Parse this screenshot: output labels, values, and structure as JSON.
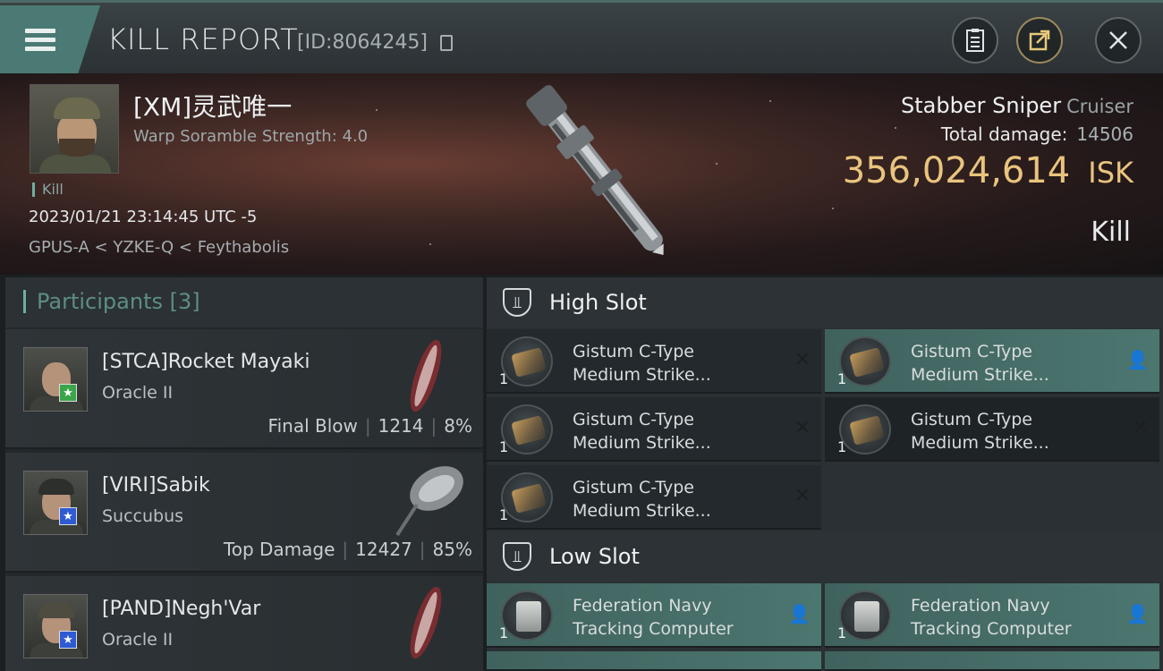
{
  "header": {
    "title": "KILL REPORT",
    "report_id": "[ID:8064245]"
  },
  "victim": {
    "name": "[XM]灵武唯一",
    "subtitle": "Warp Soramble Strength: 4.0",
    "tag": "Kill",
    "time": "2023/01/21 23:14:45 UTC -5",
    "location": "GPUS-A < YZKE-Q < Feythabolis",
    "ship_name": "Stabber Sniper",
    "ship_class": "Cruiser",
    "total_damage_label": "Total damage:",
    "total_damage": "14506",
    "isk_value": "356,024,614",
    "isk_unit": "ISK",
    "result": "Kill"
  },
  "participants": {
    "title": "Participants [3]",
    "items": [
      {
        "name": "[STCA]Rocket Mayaki",
        "ship": "Oracle II",
        "label": "Final Blow",
        "damage": "1214",
        "percent": "8%",
        "badge": "★",
        "badge_color": "#3aa54b"
      },
      {
        "name": "[VIRI]Sabik",
        "ship": "Succubus",
        "label": "Top Damage",
        "damage": "12427",
        "percent": "85%",
        "badge": "★",
        "badge_color": "#2f5bd2"
      },
      {
        "name": "[PAND]Negh'Var",
        "ship": "Oracle II",
        "label": "",
        "damage": "",
        "percent": "",
        "badge": "★",
        "badge_color": "#2f5bd2"
      }
    ]
  },
  "fitting": {
    "high_slot_title": "High Slot",
    "low_slot_title": "Low Slot",
    "high_slot": [
      {
        "name_line1": "Gistum C-Type",
        "name_line2": "Medium Strike...",
        "qty": "1",
        "status": "destroyed"
      },
      {
        "name_line1": "Gistum C-Type",
        "name_line2": "Medium Strike...",
        "qty": "1",
        "status": "dropped"
      },
      {
        "name_line1": "Gistum C-Type",
        "name_line2": "Medium Strike...",
        "qty": "1",
        "status": "destroyed"
      },
      {
        "name_line1": "Gistum C-Type",
        "name_line2": "Medium Strike...",
        "qty": "1",
        "status": "destroyed"
      },
      {
        "name_line1": "Gistum C-Type",
        "name_line2": "Medium Strike...",
        "qty": "1",
        "status": "destroyed"
      }
    ],
    "low_slot": [
      {
        "name_line1": "Federation Navy",
        "name_line2": "Tracking Computer",
        "qty": "1",
        "status": "dropped"
      },
      {
        "name_line1": "Federation Navy",
        "name_line2": "Tracking Computer",
        "qty": "1",
        "status": "dropped"
      }
    ]
  },
  "icons": {
    "destroyed": "✕",
    "dropped": "👤",
    "menu": "menu-icon",
    "clipboard": "clipboard-icon",
    "share": "share-icon",
    "close": "close-icon"
  },
  "colors": {
    "accent_teal": "#4b7a74",
    "isk_gold": "#e9c47e",
    "dropped_bg": "#4c7670"
  }
}
